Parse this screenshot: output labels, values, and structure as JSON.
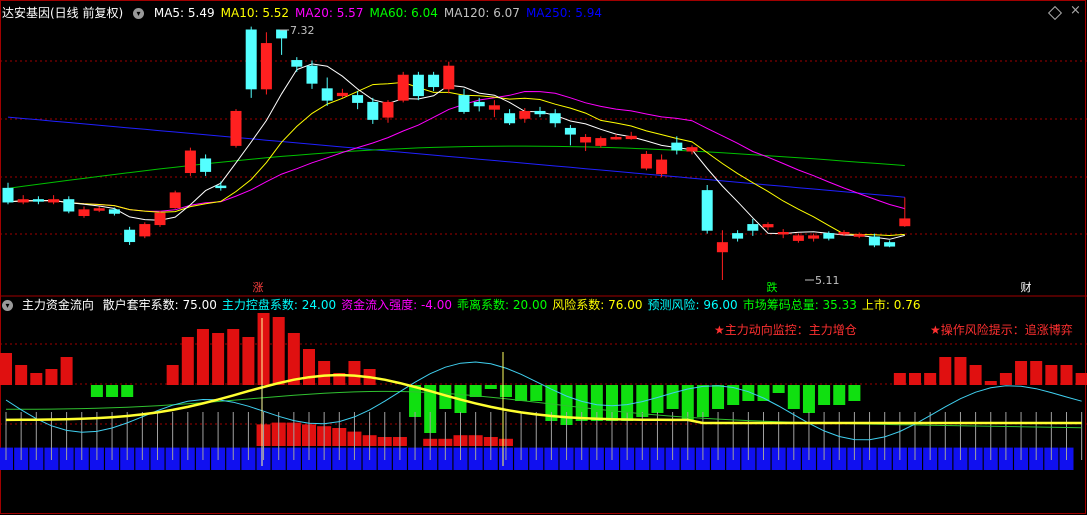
{
  "top_header": {
    "title": "达安基因(日线 前复权)",
    "ma_items": [
      {
        "label": "MA5: 5.49",
        "color": "#ffffff"
      },
      {
        "label": "MA10: 5.52",
        "color": "#ffff00"
      },
      {
        "label": "MA20: 5.57",
        "color": "#ff00ff"
      },
      {
        "label": "MA60: 6.04",
        "color": "#00ff00"
      },
      {
        "label": "MA120: 6.07",
        "color": "#c0c0c0"
      },
      {
        "label": "MA250: 5.94",
        "color": "#0000ff"
      }
    ]
  },
  "bottom_header": {
    "title": "主力资金流向",
    "items": [
      {
        "label": "散户套牢系数: 75.00",
        "color": "#ffffff"
      },
      {
        "label": "主力控盘系数: 24.00",
        "color": "#00ffff"
      },
      {
        "label": "资金流入强度: -4.00",
        "color": "#ff00ff"
      },
      {
        "label": "乖离系数: 20.00",
        "color": "#00ff00"
      },
      {
        "label": "风险系数: 76.00",
        "color": "#ffff00"
      },
      {
        "label": "预测风险: 96.00",
        "color": "#00ffff"
      },
      {
        "label": "市场筹码总量: 35.33",
        "color": "#00ff00"
      },
      {
        "label": "上市: 0.76",
        "color": "#ffff00"
      }
    ]
  },
  "alerts": {
    "left": "★主力动向监控：主力增仓",
    "right": "★操作风险提示：追涨博弈"
  },
  "markers": {
    "zhang": "涨",
    "die": "跌",
    "cai": "财",
    "high_label": "7.32",
    "low_label": "5.11"
  },
  "colors": {
    "up": "#ff2020",
    "down": "#54ffff",
    "grid": "#a00000",
    "ma250": "#2020ff",
    "ma60": "#00c000"
  },
  "chart_data": [
    {
      "type": "candlestick",
      "title": "达安基因(日线 前复权)",
      "price_high": 7.32,
      "price_low": 5.11,
      "candles": [
        [
          5.92,
          5.8,
          5.97,
          5.78
        ],
        [
          5.8,
          5.82,
          5.86,
          5.78
        ],
        [
          5.82,
          5.81,
          5.85,
          5.78
        ],
        [
          5.8,
          5.82,
          5.86,
          5.78
        ],
        [
          5.82,
          5.72,
          5.85,
          5.7
        ],
        [
          5.68,
          5.73,
          5.76,
          5.66
        ],
        [
          5.74,
          5.74,
          5.76,
          5.71
        ],
        [
          5.73,
          5.7,
          5.75,
          5.68
        ],
        [
          5.55,
          5.45,
          5.58,
          5.42
        ],
        [
          5.5,
          5.6,
          5.62,
          5.48
        ],
        [
          5.6,
          5.7,
          5.72,
          5.58
        ],
        [
          5.75,
          5.88,
          5.9,
          5.74
        ],
        [
          6.06,
          6.25,
          6.28,
          6.03
        ],
        [
          6.18,
          6.07,
          6.22,
          6.03
        ],
        [
          5.94,
          5.93,
          5.98,
          5.9
        ],
        [
          6.3,
          6.6,
          6.62,
          6.28
        ],
        [
          7.32,
          6.8,
          7.35,
          6.72
        ],
        [
          6.8,
          7.2,
          7.3,
          6.75
        ],
        [
          7.32,
          7.25,
          7.32,
          7.1
        ],
        [
          7.05,
          7.0,
          7.08,
          6.95
        ],
        [
          7.0,
          6.85,
          7.05,
          6.8
        ],
        [
          6.8,
          6.7,
          6.9,
          6.65
        ],
        [
          6.74,
          6.76,
          6.8,
          6.72
        ],
        [
          6.74,
          6.68,
          6.78,
          6.62
        ],
        [
          6.68,
          6.53,
          6.72,
          6.49
        ],
        [
          6.55,
          6.68,
          6.7,
          6.5
        ],
        [
          6.7,
          6.92,
          6.95,
          6.68
        ],
        [
          6.92,
          6.74,
          6.95,
          6.7
        ],
        [
          6.92,
          6.82,
          6.95,
          6.78
        ],
        [
          6.8,
          7.0,
          7.04,
          6.76
        ],
        [
          6.74,
          6.6,
          6.8,
          6.58
        ],
        [
          6.68,
          6.65,
          6.72,
          6.6
        ],
        [
          6.62,
          6.65,
          6.7,
          6.55
        ],
        [
          6.58,
          6.5,
          6.62,
          6.48
        ],
        [
          6.54,
          6.6,
          6.63,
          6.5
        ],
        [
          6.6,
          6.58,
          6.64,
          6.55
        ],
        [
          6.58,
          6.5,
          6.62,
          6.46
        ],
        [
          6.45,
          6.4,
          6.48,
          6.3
        ],
        [
          6.33,
          6.37,
          6.4,
          6.25
        ],
        [
          6.3,
          6.36,
          6.38,
          6.28
        ],
        [
          6.37,
          6.37,
          6.4,
          6.35
        ],
        [
          6.36,
          6.38,
          6.42,
          6.35
        ],
        [
          6.1,
          6.22,
          6.25,
          6.08
        ],
        [
          6.05,
          6.17,
          6.22,
          6.02
        ],
        [
          6.32,
          6.26,
          6.38,
          6.22
        ],
        [
          6.25,
          6.28,
          6.3,
          6.22
        ],
        [
          5.9,
          5.55,
          5.95,
          5.52
        ],
        [
          5.36,
          5.44,
          5.55,
          5.11
        ],
        [
          5.52,
          5.48,
          5.55,
          5.45
        ],
        [
          5.6,
          5.55,
          5.65,
          5.5
        ],
        [
          5.58,
          5.6,
          5.62,
          5.55
        ],
        [
          5.52,
          5.53,
          5.56,
          5.48
        ],
        [
          5.46,
          5.5,
          5.52,
          5.44
        ],
        [
          5.48,
          5.5,
          5.52,
          5.45
        ],
        [
          5.52,
          5.48,
          5.54,
          5.46
        ],
        [
          5.52,
          5.53,
          5.55,
          5.5
        ],
        [
          5.5,
          5.51,
          5.53,
          5.48
        ],
        [
          5.49,
          5.42,
          5.52,
          5.4
        ],
        [
          5.44,
          5.41,
          5.46,
          5.4
        ],
        [
          5.59,
          5.65,
          5.84,
          5.58
        ]
      ]
    },
    {
      "type": "bar",
      "title": "主力资金流向",
      "red_green_bars": [
        4,
        2.5,
        1.5,
        2,
        3.5,
        0,
        -1.5,
        -1.5,
        -1.5,
        0,
        0,
        2.5,
        6,
        7,
        6.5,
        7,
        6,
        9,
        8.5,
        6.5,
        4.5,
        3,
        1.5,
        3,
        2,
        0,
        0,
        -4,
        -6,
        -3,
        -3.5,
        -1.5,
        -0.5,
        -1.5,
        -2,
        -2,
        -4.5,
        -5,
        -4.5,
        -4.5,
        -4.5,
        -4.5,
        -4,
        -3.5,
        -3,
        -4.5,
        -4,
        -3,
        -2.5,
        -2,
        -2,
        -1,
        -3,
        -3.5,
        -2.5,
        -2.5,
        -2,
        0,
        0,
        1.5,
        1.5,
        1.5,
        3.5,
        3.5,
        2.5,
        0.5,
        1.5,
        3,
        3,
        2.5,
        2.5,
        1.5
      ],
      "blue_bars": [
        3.2,
        3.2,
        3.2,
        3.2,
        3.2,
        3.2,
        3.2,
        3.2,
        3.2,
        3.2,
        3.2,
        3.2,
        3.2,
        3.2,
        3.2,
        3.2,
        3.2,
        3.2,
        3.2,
        3.2,
        3.2,
        3.2,
        3.2,
        3.2,
        3.2,
        3.2,
        3.2,
        3.2,
        3.2,
        3.2,
        3.2,
        3.2,
        3.2,
        3.2,
        3.2,
        3.2,
        3.2,
        3.2,
        3.2,
        3.2,
        3.2,
        3.2,
        3.2,
        3.2,
        3.2,
        3.2,
        3.2,
        3.2,
        3.2,
        3.2,
        3.2,
        3.2,
        3.2,
        3.2,
        3.2,
        3.2,
        3.2,
        3.2,
        3.2,
        3.2,
        3.2,
        3.2,
        3.2,
        3.2,
        3.2,
        3.2,
        3.2,
        3.2,
        3.2,
        3.2,
        3.2
      ],
      "red_pillars": [
        0,
        0,
        0,
        0,
        0,
        0,
        0,
        0,
        0,
        0,
        0,
        0,
        0,
        0,
        0,
        0,
        0,
        1.2,
        1.3,
        1.3,
        1.2,
        1.1,
        1.0,
        0.8,
        0.6,
        0.5,
        0.5,
        0,
        0.4,
        0.4,
        0.6,
        0.6,
        0.5,
        0.4,
        0,
        0,
        0,
        0,
        0,
        0,
        0,
        0,
        0,
        0,
        0,
        0,
        0,
        0,
        0,
        0,
        0,
        0,
        0,
        0,
        0,
        0,
        0,
        0,
        0,
        0,
        0,
        0,
        0,
        0,
        0,
        0,
        0,
        0,
        0,
        0,
        0
      ]
    }
  ]
}
